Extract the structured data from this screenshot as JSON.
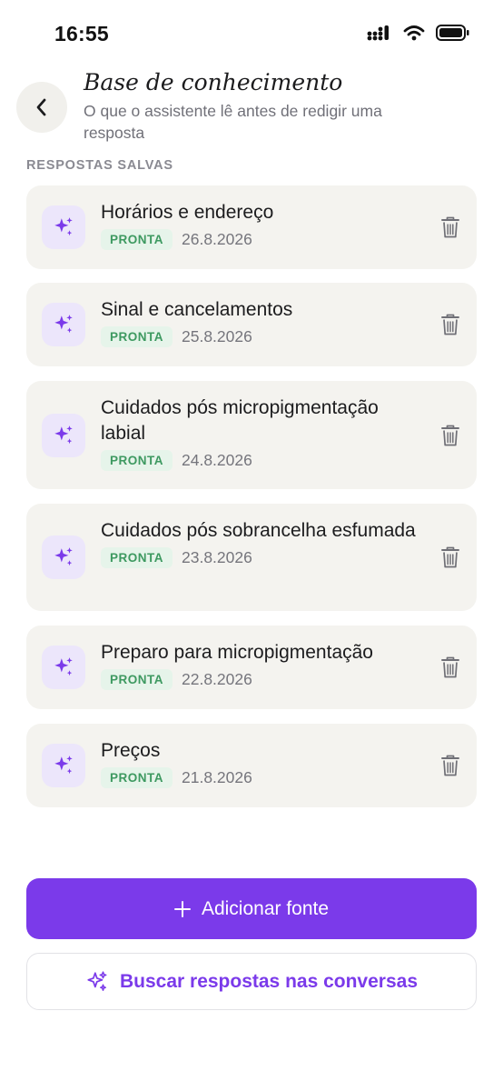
{
  "status": {
    "time": "16:55"
  },
  "header": {
    "title": "Base de conhecimento",
    "subtitle": "O que o assistente lê antes de redigir uma resposta"
  },
  "section_label": "RESPOSTAS SALVAS",
  "items": [
    {
      "title": "Horários e endereço",
      "status": "PRONTA",
      "date": "26.8.2026"
    },
    {
      "title": "Sinal e cancelamentos",
      "status": "PRONTA",
      "date": "25.8.2026"
    },
    {
      "title": "Cuidados pós micropigmentação labial",
      "status": "PRONTA",
      "date": "24.8.2026"
    },
    {
      "title": "Cuidados pós sobrancelha esfumada",
      "status": "PRONTA",
      "date": "23.8.2026"
    },
    {
      "title": "Preparo para micropigmentação",
      "status": "PRONTA",
      "date": "22.8.2026"
    },
    {
      "title": "Preços",
      "status": "PRONTA",
      "date": "21.8.2026"
    }
  ],
  "actions": {
    "add_source": "Adicionar fonte",
    "search_answers": "Buscar respostas nas conversas"
  },
  "icons": {
    "back": "chevron-left-icon",
    "item": "sparkles-icon",
    "delete": "trash-icon",
    "add": "plus-icon"
  },
  "colors": {
    "accent": "#7b3aea",
    "card_bg": "#f4f3ef",
    "icon_bg": "#ece6fb",
    "badge_bg": "#e6f4ea",
    "badge_text": "#3d9960"
  }
}
